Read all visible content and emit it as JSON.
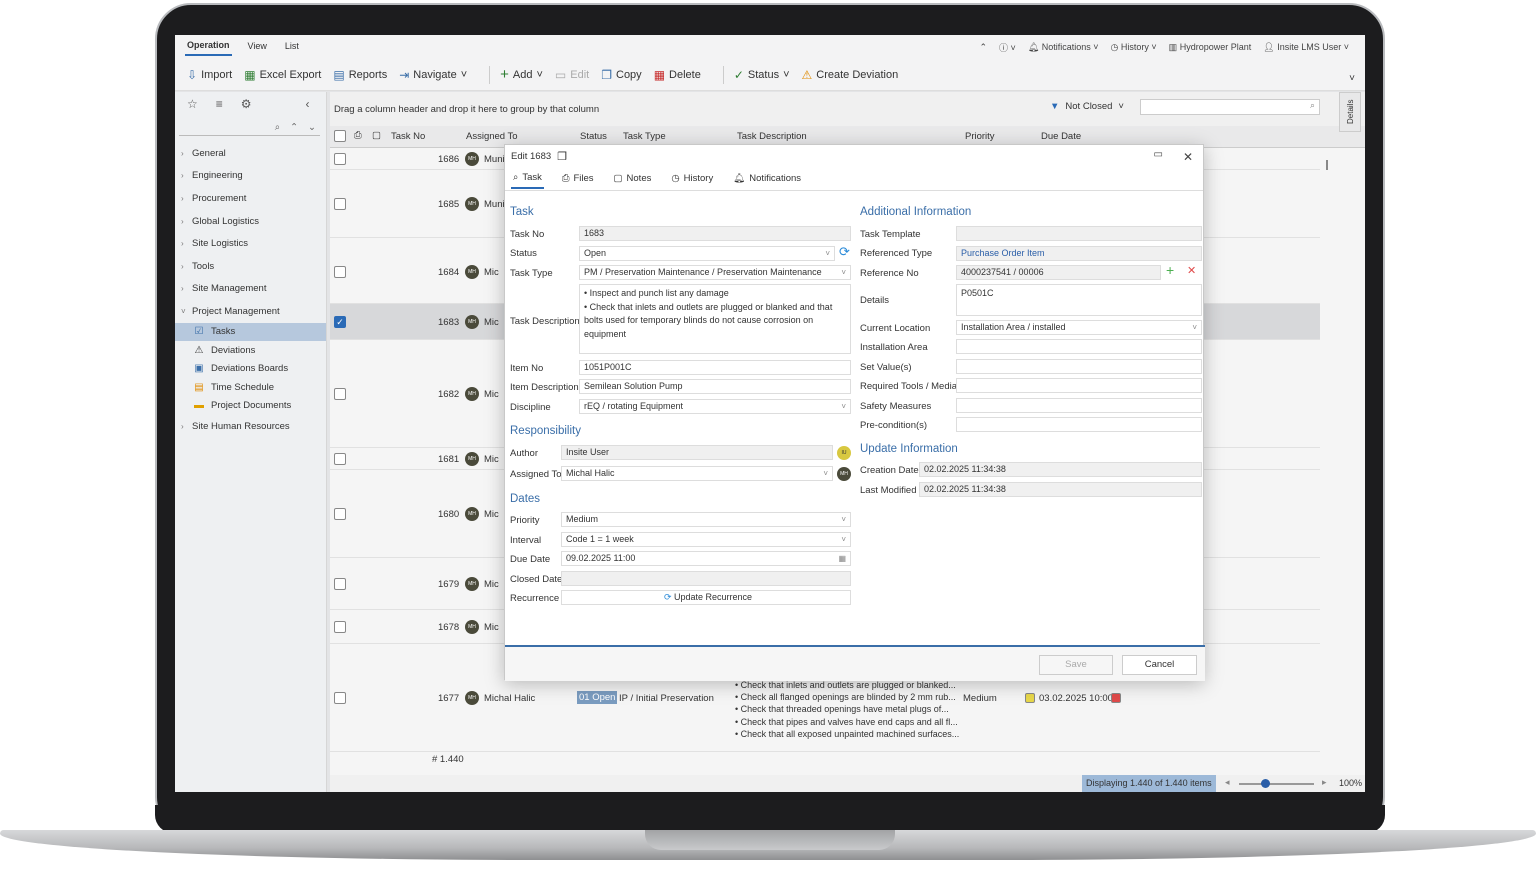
{
  "menubar": {
    "tabs": [
      "Operation",
      "View",
      "List"
    ],
    "notifications": "Notifications",
    "history": "History",
    "plant": "Hydropower Plant",
    "user": "Insite LMS User"
  },
  "toolbar": {
    "import": "Import",
    "excel_export": "Excel Export",
    "reports": "Reports",
    "navigate": "Navigate",
    "add": "Add",
    "edit": "Edit",
    "copy": "Copy",
    "delete": "Delete",
    "status": "Status",
    "create_deviation": "Create Deviation"
  },
  "sidebar": {
    "items": [
      "General",
      "Engineering",
      "Procurement",
      "Global Logistics",
      "Site Logistics",
      "Tools",
      "Site Management",
      "Project Management"
    ],
    "sub_items": [
      "Tasks",
      "Deviations",
      "Deviations Boards",
      "Time Schedule",
      "Project Documents"
    ],
    "last_item": "Site Human Resources"
  },
  "grid": {
    "group_hint": "Drag a column header and drop it here to group by that column",
    "filter": "Not Closed",
    "columns": [
      "Task No",
      "Assigned To",
      "Status",
      "Task Type",
      "Task Description",
      "Priority",
      "Due Date"
    ],
    "rows": [
      {
        "no": "1686",
        "assigned": "Muni"
      },
      {
        "no": "1685",
        "assigned": "Muni"
      },
      {
        "no": "1684",
        "assigned": "Mic"
      },
      {
        "no": "1683",
        "assigned": "Mic"
      },
      {
        "no": "1682",
        "assigned": "Mic"
      },
      {
        "no": "1681",
        "assigned": "Mic"
      },
      {
        "no": "1680",
        "assigned": "Mic"
      },
      {
        "no": "1679",
        "assigned": "Mic"
      },
      {
        "no": "1678",
        "assigned": "Mic"
      },
      {
        "no": "1677",
        "assigned": "Michal Halic"
      }
    ],
    "row1677": {
      "status": "01 Open",
      "type": "IP / Initial Preservation",
      "desc": [
        "• Check that inlets and outlets are plugged or blanked...",
        "• Check all flanged openings are blinded by 2 mm rub...",
        "• Check that threaded openings have metal plugs of...",
        "• Check that pipes and valves have end caps and all fl...",
        "• Check that all exposed unpainted machined surfaces..."
      ],
      "priority": "Medium",
      "due": "03.02.2025 10:00"
    },
    "count": "# 1.440",
    "displaying": "Displaying 1.440 of 1.440 items",
    "zoom": "100%",
    "details_tab": "Details",
    "avatar_initials": "MH"
  },
  "dialog": {
    "title": "Edit 1683",
    "tabs": [
      "Task",
      "Files",
      "Notes",
      "History",
      "Notifications"
    ],
    "task_section": "Task",
    "task_no_label": "Task No",
    "task_no": "1683",
    "status_label": "Status",
    "status": "Open",
    "task_type_label": "Task Type",
    "task_type": "PM / Preservation Maintenance / Preservation Maintenance",
    "desc_label": "Task Description",
    "desc_line1": "• Inspect and punch list any damage",
    "desc_line2": "• Check that inlets and outlets are plugged or blanked and that bolts used for temporary blinds do not cause corrosion on equipment",
    "item_no_label": "Item No",
    "item_no": "1051P001C",
    "item_desc_label": "Item Description",
    "item_desc": "Semilean Solution Pump",
    "discipline_label": "Discipline",
    "discipline": "rEQ / rotating Equipment",
    "resp_section": "Responsibility",
    "author_label": "Author",
    "author": "Insite User",
    "author_initials": "IU",
    "assigned_label": "Assigned To",
    "assigned": "Michal Halic",
    "dates_section": "Dates",
    "priority_label": "Priority",
    "priority": "Medium",
    "interval_label": "Interval",
    "interval": "Code 1 = 1 week",
    "due_label": "Due Date",
    "due": "09.02.2025 11:00",
    "closed_label": "Closed Date",
    "recurrence_label": "Recurrence",
    "update_recurrence": "Update Recurrence",
    "add_section": "Additional Information",
    "template_label": "Task Template",
    "ref_type_label": "Referenced Type",
    "ref_type": "Purchase Order Item",
    "ref_no_label": "Reference No",
    "ref_no": "4000237541 / 00006",
    "details_label": "Details",
    "details": "P0501C",
    "location_label": "Current Location",
    "location": "Installation Area / installed",
    "install_area_label": "Installation Area",
    "set_values_label": "Set Value(s)",
    "tools_label": "Required Tools / Media",
    "safety_label": "Safety Measures",
    "precond_label": "Pre-condition(s)",
    "update_section": "Update Information",
    "creation_label": "Creation Date",
    "creation": "02.02.2025 11:34:38",
    "modified_label": "Last Modified",
    "modified": "02.02.2025 11:34:38",
    "save": "Save",
    "cancel": "Cancel"
  }
}
